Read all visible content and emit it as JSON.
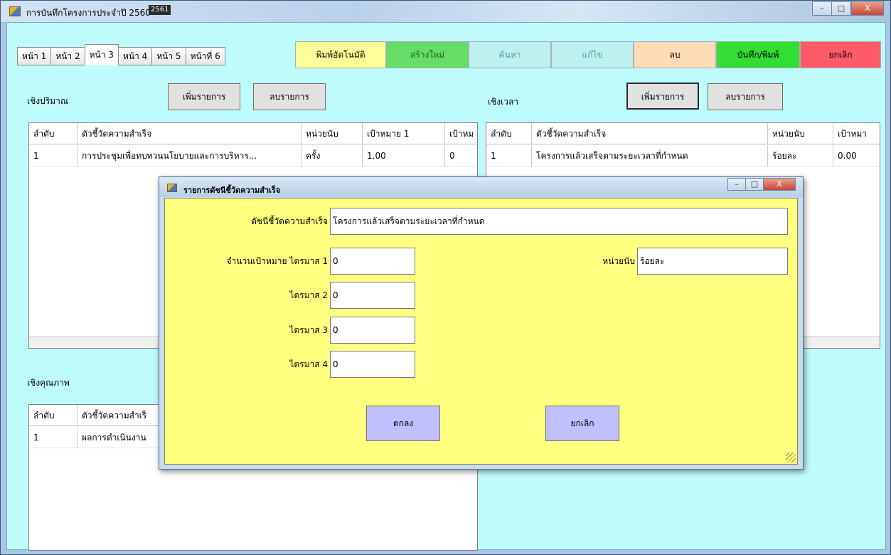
{
  "window": {
    "title": "การบันทึกโครงการประจำปี 2560",
    "title_year_badge": "2561",
    "caption_buttons": {
      "minimize": "–",
      "maximize": "□",
      "close": "X"
    }
  },
  "tabs": [
    "หน้า 1",
    "หน้า 2",
    "หน้า 3",
    "หน้า 4",
    "หน้า 5",
    "หน้าที่ 6"
  ],
  "active_tab": "หน้า 3",
  "actions": {
    "auto_print": "พิมพ์อัตโนมัติ",
    "new": "สร้างใหม่",
    "search": "ค้นหา",
    "edit": "แก้ไข",
    "delete": "ลบ",
    "save_print": "บันทึก/พิมพ์",
    "cancel": "ยกเลิก"
  },
  "colors": {
    "client_bg": "#c0fbfc",
    "auto_print": "#ffff99",
    "new": "#66dd66",
    "search": "#bff0f0",
    "edit": "#bff0f0",
    "delete": "#ffdcb8",
    "save_print": "#33dd33",
    "cancel": "#ff5a68",
    "dialog_body": "#ffff80",
    "dialog_button": "#c0c0ff"
  },
  "quantitative": {
    "label": "เชิงปริมาณ",
    "add_button": "เพิ่มรายการ",
    "remove_button": "ลบรายการ",
    "columns": [
      "ลำดับ",
      "ตัวชี้วัดความสำเร็จ",
      "หน่วยนับ",
      "เป้าหมาย 1",
      "เป้าหม"
    ],
    "rows": [
      [
        "1",
        "การประชุมเพื่อทบทวนนโยบายและการบริหาร...",
        "ครั้ง",
        "1.00",
        "0"
      ]
    ]
  },
  "time_based": {
    "label": "เชิงเวลา",
    "add_button": "เพิ่มรายการ",
    "remove_button": "ลบรายการ",
    "columns": [
      "ลำดับ",
      "ตัวชี้วัดความสำเร็จ",
      "หน่วยนับ",
      "เป้าหมา"
    ],
    "rows": [
      [
        "1",
        "โครงการแล้วเสร็จตามระยะเวลาที่กำหนด",
        "ร้อยละ",
        "0.00"
      ]
    ]
  },
  "qualitative": {
    "label": "เชิงคุณภาพ",
    "columns": [
      "ลำดับ",
      "ตัวชี้วัดความสำเร็"
    ],
    "rows": [
      [
        "1",
        "ผลการดำเนินงาน"
      ]
    ]
  },
  "dialog": {
    "title": "รายการดัชนีชี้วัดความสำเร็จ",
    "indicator_label": "ดัชนีชี้วัดความสำเร็จ",
    "indicator_value": "โครงการแล้วเสร็จตามระยะเวลาที่กำหนด",
    "q1_label": "จำนวนเป้าหมาย ไตรมาส 1",
    "q1_value": "0",
    "q2_label": "ไตรมาส 2",
    "q2_value": "0",
    "q3_label": "ไตรมาส 3",
    "q3_value": "0",
    "q4_label": "ไตรมาส 4",
    "q4_value": "0",
    "unit_label": "หน่วยนับ",
    "unit_value": "ร้อยละ",
    "ok_button": "ตกลง",
    "cancel_button": "ยกเลิก"
  }
}
